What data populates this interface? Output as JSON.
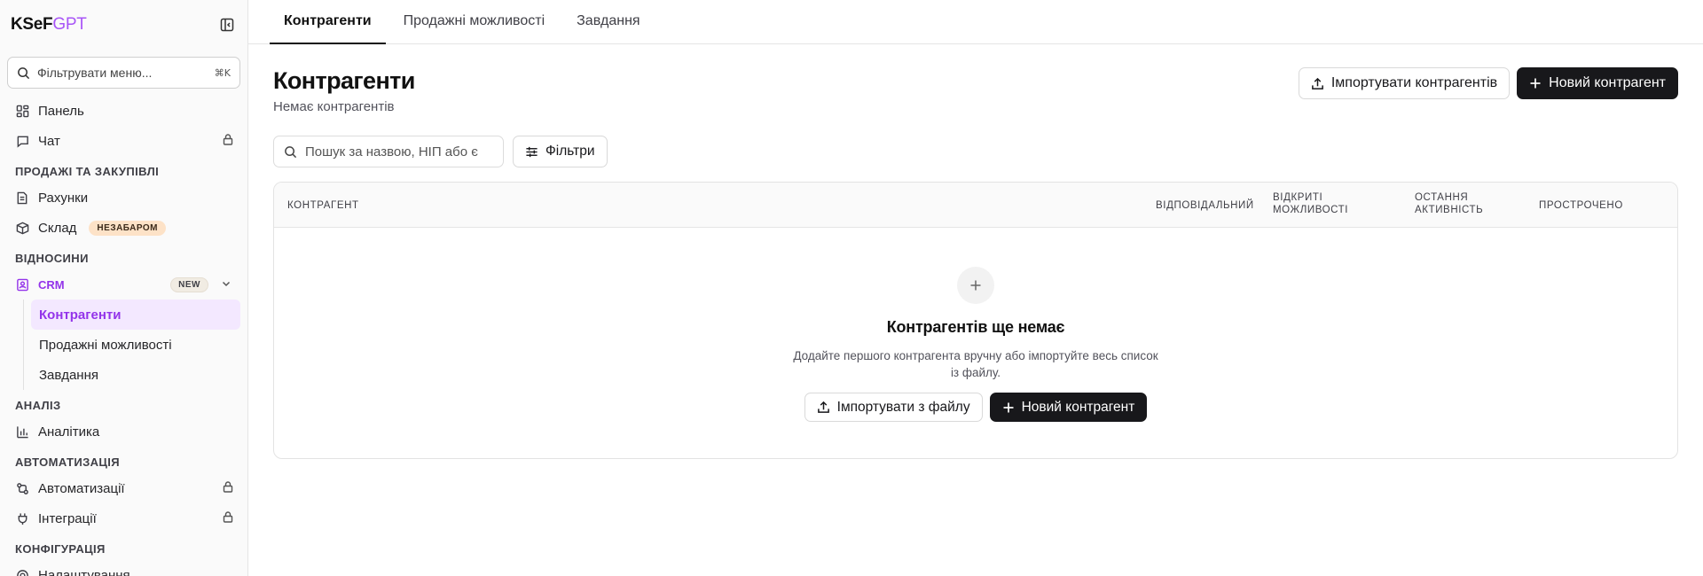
{
  "brand": {
    "part1": "KSeF",
    "part2": "GPT"
  },
  "sidebar": {
    "filter_placeholder": "Фільтрувати меню...",
    "filter_shortcut": "⌘K",
    "top_items": [
      {
        "label": "Панель"
      },
      {
        "label": "Чат",
        "locked": true
      }
    ],
    "sections": {
      "sales": "ПРОДАЖІ ТА ЗАКУПІВЛІ",
      "relations": "ВІДНОСИНИ",
      "analysis": "АНАЛІЗ",
      "automation": "АВТОМАТИЗАЦІЯ",
      "config": "КОНФІГУРАЦІЯ"
    },
    "sales_items": [
      {
        "label": "Рахунки"
      },
      {
        "label": "Склад",
        "badge": "НЕЗАБАРОМ"
      }
    ],
    "crm": {
      "label": "CRM",
      "badge": "NEW",
      "children": [
        {
          "label": "Контрагенти",
          "active": true
        },
        {
          "label": "Продажні можливості"
        },
        {
          "label": "Завдання"
        }
      ]
    },
    "analysis_items": [
      {
        "label": "Аналітика"
      }
    ],
    "automation_items": [
      {
        "label": "Автоматизації",
        "locked": true
      },
      {
        "label": "Інтеграції",
        "locked": true
      }
    ],
    "config_items": [
      {
        "label": "Налаштування"
      }
    ]
  },
  "tabs": [
    {
      "label": "Контрагенти",
      "active": true
    },
    {
      "label": "Продажні можливості"
    },
    {
      "label": "Завдання"
    }
  ],
  "page": {
    "title": "Контрагенти",
    "subtitle": "Немає контрагентів",
    "import_button": "Імпортувати контрагентів",
    "new_button": "Новий контрагент",
    "search_placeholder": "Пошук за назвою, НІП або є",
    "filters_button": "Фільтри"
  },
  "table": {
    "columns": [
      "КОНТРАГЕНТ",
      "ВІДПОВІДАЛЬНИЙ",
      "ВІДКРИТІ МОЖЛИВОСТІ",
      "ОСТАННЯ АКТИВНІСТЬ",
      "ПРОСТРОЧЕНО"
    ]
  },
  "empty_state": {
    "icon": "plus-icon",
    "title": "Контрагентів ще немає",
    "description": "Додайте першого контрагента вручну або імпортуйте весь список із файлу.",
    "import_button": "Імпортувати з файлу",
    "new_button": "Новий контрагент"
  },
  "colors": {
    "accent": "#9333ea",
    "accent_bg": "#f3e8ff",
    "dark": "#18181b",
    "badge_soon_bg": "#fde2c7"
  }
}
